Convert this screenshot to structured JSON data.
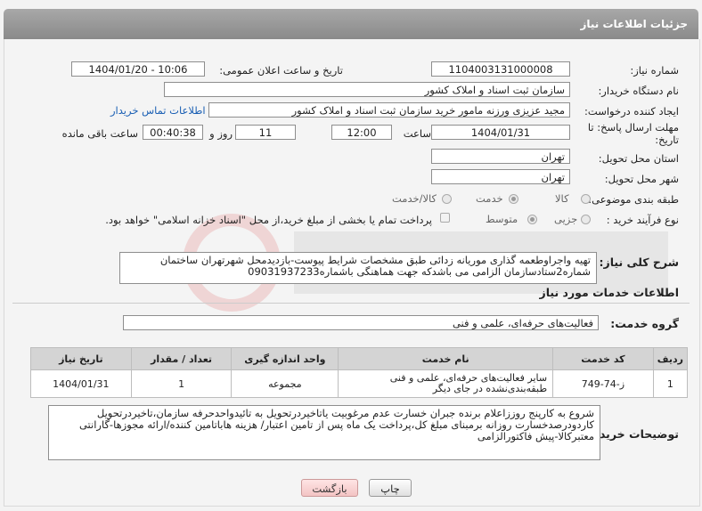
{
  "header": {
    "title": "جزئیات اطلاعات نیاز"
  },
  "form": {
    "need_number_label": "شماره نیاز:",
    "need_number": "1104003131000008",
    "announce_label": "تاریخ و ساعت اعلان عمومی:",
    "announce_value": "1404/01/20 - 10:06",
    "buyer_org_label": "نام دستگاه خریدار:",
    "buyer_org": "سازمان ثبت اسناد و املاک کشور",
    "creator_label": "ایجاد کننده درخواست:",
    "creator": "مجید عزیزی ورزنه مامور خرید سازمان ثبت اسناد و املاک کشور",
    "contact_link": "اطلاعات تماس خریدار",
    "deadline_label": "مهلت ارسال پاسخ: تا تاریخ:",
    "deadline_date": "1404/01/31",
    "time_label": "ساعت",
    "deadline_time": "12:00",
    "days_value": "11",
    "days_label": "روز و",
    "remaining_time": "00:40:38",
    "remaining_label": "ساعت باقی مانده",
    "province_label": "استان محل تحویل:",
    "province": "تهران",
    "city_label": "شهر محل تحویل:",
    "city": "تهران",
    "category_label": "طبقه بندی موضوعی:",
    "category_options": [
      "کالا",
      "خدمت",
      "کالا/خدمت"
    ],
    "category_selected": "خدمت",
    "process_label": "نوع فرآیند خرید :",
    "process_options": [
      "جزیی",
      "متوسط"
    ],
    "process_selected": "متوسط",
    "payment_note": "پرداخت تمام یا بخشی از مبلغ خرید،از محل \"اسناد خزانه اسلامی\" خواهد بود."
  },
  "description": {
    "label": "شرح کلی نیاز:",
    "text": "تهیه واجراوطعمه گذاری موریانه زدائی طبق مشخصات شرایط پیوست-بازدیدمحل شهرتهران ساختمان شماره2ستادسازمان الزامی می باشدکه جهت هماهنگی باشماره09031937233"
  },
  "services": {
    "section_title": "اطلاعات خدمات مورد نیاز",
    "group_label": "گروه خدمت:",
    "group_value": "فعالیت‌های حرفه‌ای، علمی و فنی",
    "columns": [
      "ردیف",
      "کد خدمت",
      "نام خدمت",
      "واحد اندازه گیری",
      "تعداد / مقدار",
      "تاریخ نیاز"
    ],
    "rows": [
      [
        "1",
        "ز-74-749",
        "سایر فعالیت‌های حرفه‌ای، علمی و فنی طبقه‌بندی‌نشده در جای دیگر",
        "مجموعه",
        "1",
        "1404/01/31"
      ]
    ]
  },
  "buyer_notes": {
    "label": "توضیحات خریدار:",
    "text": "شروع به کارپنج روززاعلام برنده جبران خسارت عدم مرغوبیت یاتاخیردرتحویل به تائیدواحدحرفه سازمان،تاخیردرتحویل کاردودرصدخسارت روزانه برمبنای مبلغ کل،پرداخت یک ماه پس از تامین اعتبار/ هزینه هاباتامین کننده/ارائه مجوزها-گارانتی معتبرکالا-پیش فاکتورالزامی"
  },
  "buttons": {
    "print": "چاپ",
    "back": "بازگشت"
  },
  "colors": {
    "header_bg": "#999999",
    "link": "#1a5fb4",
    "back_button": "#f3c4c4"
  }
}
